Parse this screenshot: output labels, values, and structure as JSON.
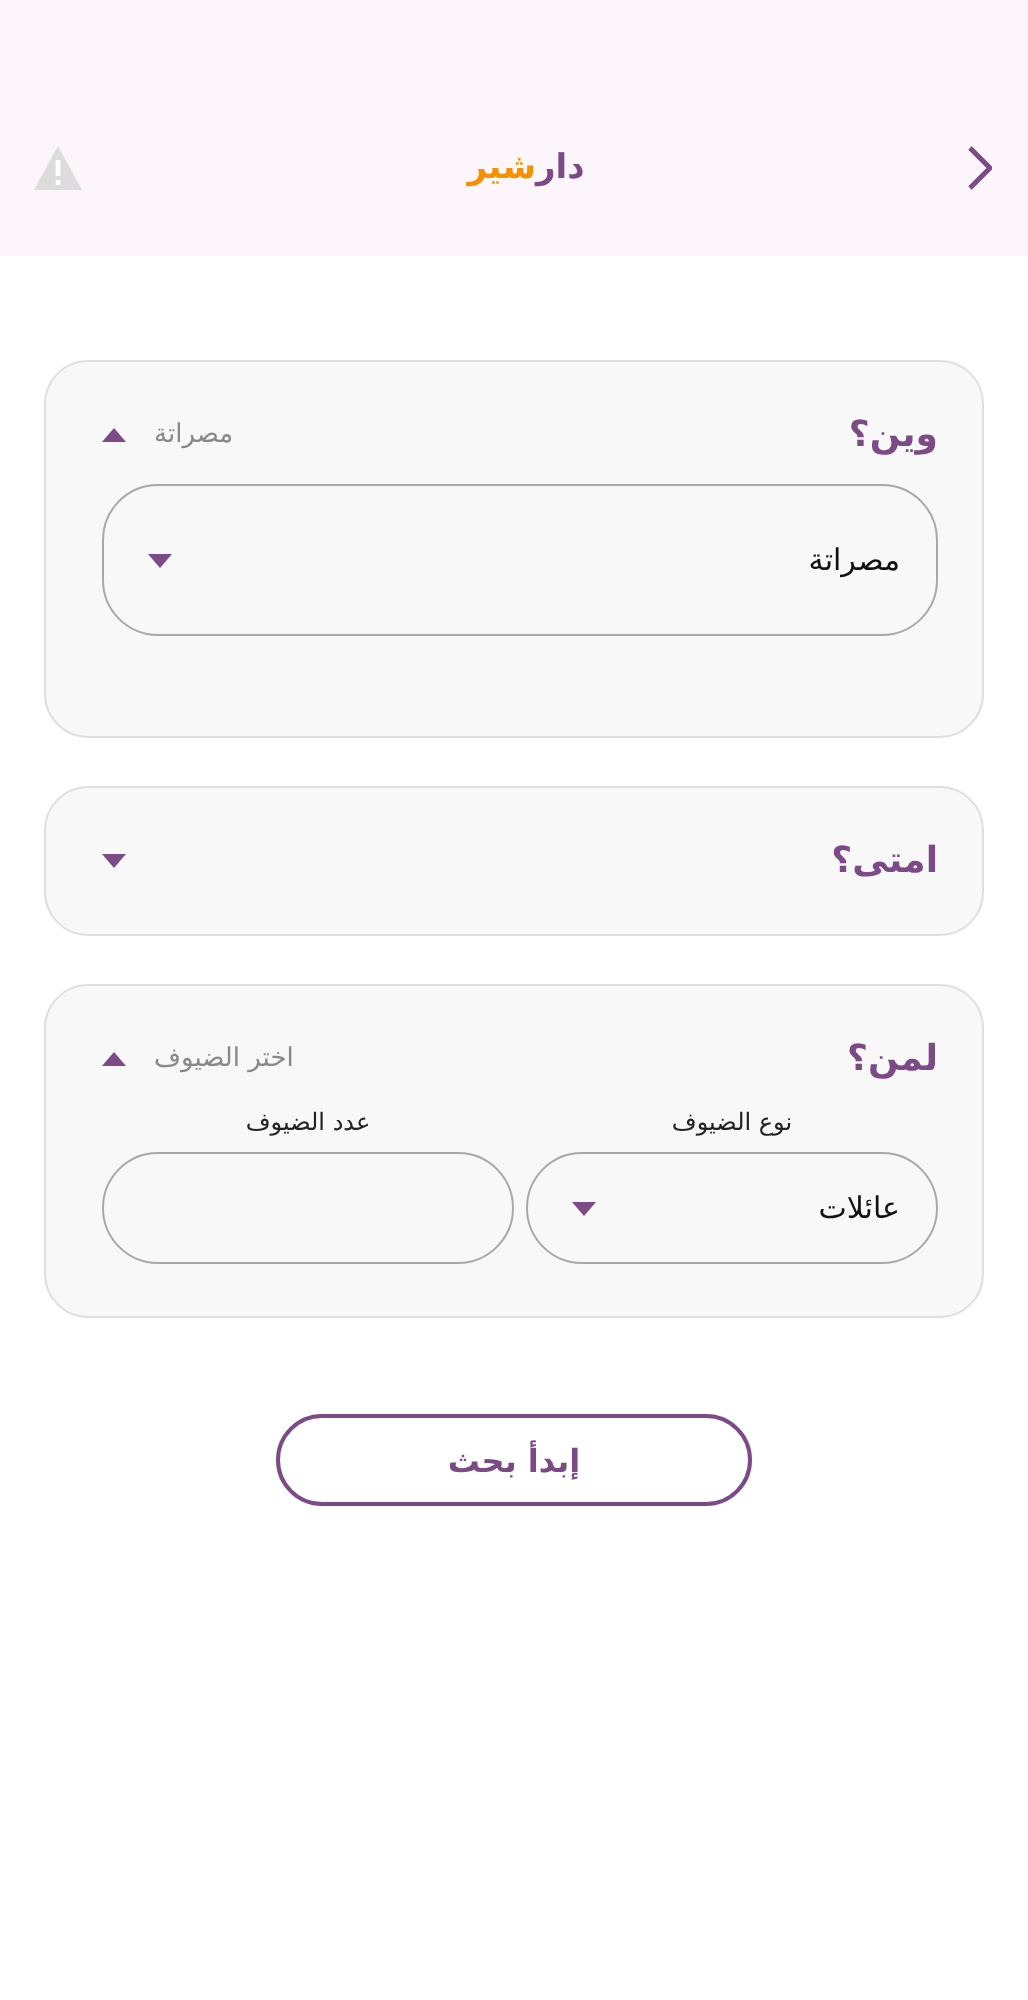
{
  "header": {
    "logo": [
      {
        "text": "دار",
        "color": "#7b4a87"
      },
      {
        "text": "شير",
        "color": "#f39200"
      }
    ]
  },
  "sections": [
    {
      "title": "وين؟",
      "summary": "مصراتة",
      "expanded": true,
      "fields": [
        {
          "kind": "dropdown",
          "value": "مصراتة"
        }
      ]
    },
    {
      "title": "امتى؟",
      "expanded": false
    },
    {
      "title": "لمن؟",
      "summary": "اختر الضيوف",
      "expanded": true,
      "fields": [
        {
          "kind": "dropdown",
          "label": "نوع الضيوف",
          "value": "عائلات"
        },
        {
          "kind": "input",
          "label": "عدد الضيوف"
        }
      ]
    }
  ],
  "search_button": "إبدأ بحث"
}
